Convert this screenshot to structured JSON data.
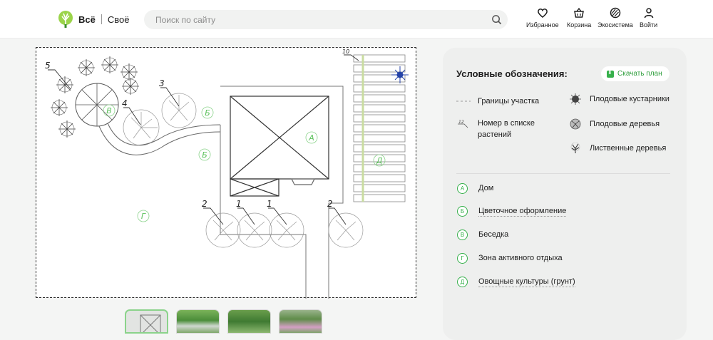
{
  "header": {
    "logo_text": "Всё",
    "logo_text2": "Своё",
    "search_placeholder": "Поиск по сайту",
    "nav": [
      {
        "label": "Избранное",
        "icon": "heart-icon"
      },
      {
        "label": "Корзина",
        "icon": "basket-icon"
      },
      {
        "label": "Экосистема",
        "icon": "ecosystem-icon"
      },
      {
        "label": "Войти",
        "icon": "user-icon"
      }
    ]
  },
  "plan": {
    "zone_labels": [
      "А",
      "Б",
      "Б",
      "В",
      "Г",
      "Д"
    ],
    "plant_numbers": [
      "5",
      "3",
      "4",
      "2",
      "1",
      "1",
      "2",
      "10"
    ]
  },
  "legend": {
    "title": "Условные обозначения:",
    "download_label": "Скачать план",
    "symbols": [
      {
        "label": "Границы участка",
        "icon": "dashed-line-icon"
      },
      {
        "label": "Номер в списке растений",
        "icon": "plant-number-icon"
      },
      {
        "label": "Плодовые кустарники",
        "icon": "fruit-shrub-icon"
      },
      {
        "label": "Плодовые деревья",
        "icon": "fruit-tree-icon"
      },
      {
        "label": "Лиственные деревья",
        "icon": "deciduous-tree-icon"
      }
    ],
    "zones": [
      {
        "letter": "А",
        "label": "Дом"
      },
      {
        "letter": "Б",
        "label": "Цветочное оформление"
      },
      {
        "letter": "В",
        "label": "Беседка"
      },
      {
        "letter": "Г",
        "label": "Зона активного отдыха"
      },
      {
        "letter": "Д",
        "label": "Овощные культуры (грунт)"
      }
    ]
  },
  "colors": {
    "accent": "#35b04a",
    "panel": "#eeefee",
    "page": "#f4f5f4"
  }
}
